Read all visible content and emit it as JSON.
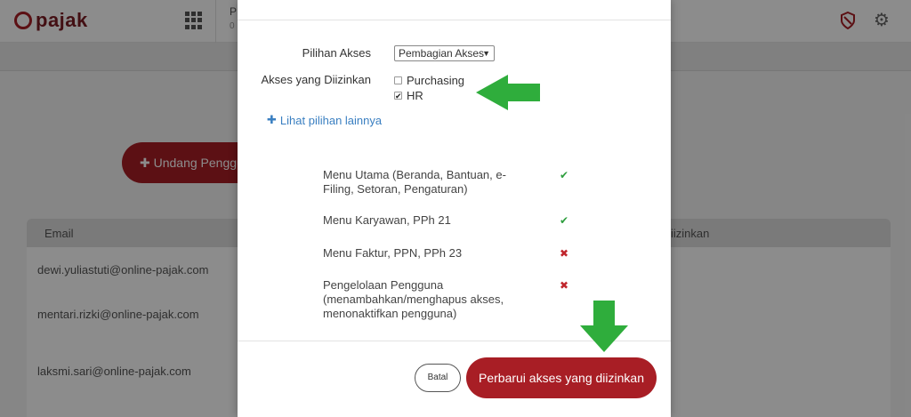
{
  "app": {
    "logo_text": "pajak",
    "header_fragment_1": "P",
    "header_fragment_2": "0",
    "icons": [
      "grid-icon",
      "shield-icon",
      "gear-icon"
    ]
  },
  "background": {
    "invite_button_label": "Undang Penggun",
    "table_headers": [
      "Email",
      "iizinkan"
    ],
    "emails": [
      "dewi.yuliastuti@online-pajak.com",
      "mentari.rizki@online-pajak.com",
      "laksmi.sari@online-pajak.com"
    ]
  },
  "modal": {
    "pilihan_akses_label": "Pilihan Akses",
    "pilihan_akses_value": "Pembagian Akses",
    "akses_diizinkan_label": "Akses yang Diizinkan",
    "options": [
      {
        "label": "Purchasing",
        "checked": false
      },
      {
        "label": "HR",
        "checked": true
      }
    ],
    "more_link": "Lihat pilihan lainnya",
    "menu_items": [
      {
        "text": "Menu Utama (Beranda, Bantuan, e-Filing, Setoran, Pengaturan)",
        "allowed": true
      },
      {
        "text": "Menu Karyawan, PPh 21",
        "allowed": true
      },
      {
        "text": "Menu Faktur, PPN, PPh 23",
        "allowed": false
      },
      {
        "text": "Pengelolaan Pengguna (menambahkan/menghapus akses, menonaktifkan pengguna)",
        "allowed": false
      }
    ],
    "cancel_label": "Batal",
    "submit_label": "Perbarui akses yang diizinkan"
  },
  "colors": {
    "brand": "#a81e25",
    "link": "#3a7fc1",
    "allowed": "#2e9e3e",
    "denied": "#c0262d",
    "annotation_arrow": "#2fad3c"
  }
}
